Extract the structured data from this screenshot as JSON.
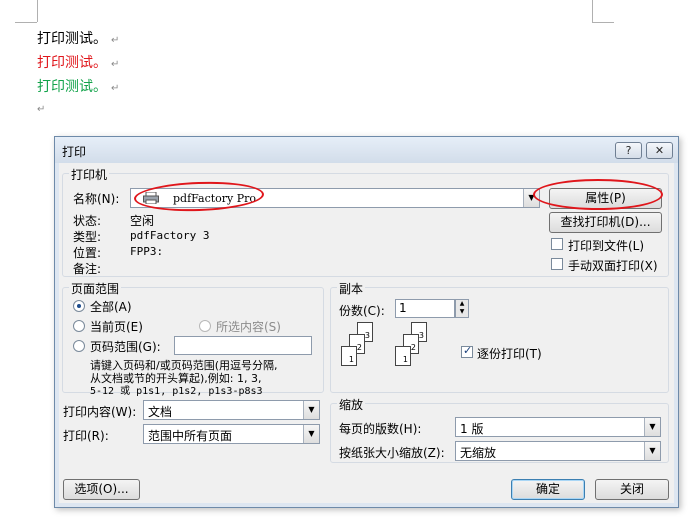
{
  "document": {
    "lines": [
      {
        "text": "打印测试。",
        "color": "#000000"
      },
      {
        "text": "打印测试。",
        "color": "#e0161b"
      },
      {
        "text": "打印测试。",
        "color": "#12a34a"
      }
    ],
    "paragraph_mark": "↵"
  },
  "dialog": {
    "title": "打印",
    "help_label": "?",
    "close_label": "✕",
    "printer": {
      "group_label": "打印机",
      "name_label": "名称(N):",
      "name_value": "pdfFactory Pro",
      "status_label": "状态:",
      "status_value": "空闲",
      "type_label": "类型:",
      "type_value": "pdfFactory 3",
      "location_label": "位置:",
      "location_value": "FPP3:",
      "comment_label": "备注:",
      "comment_value": "",
      "properties_button": "属性(P)",
      "find_printer_button": "查找打印机(D)...",
      "print_to_file_label": "打印到文件(L)",
      "print_to_file_checked": false,
      "duplex_label": "手动双面打印(X)",
      "duplex_checked": false
    },
    "page_range": {
      "group_label": "页面范围",
      "all_label": "全部(A)",
      "current_label": "当前页(E)",
      "selection_label": "所选内容(S)",
      "pages_label": "页码范围(G):",
      "pages_value": "",
      "selected": "all",
      "hint_line1": "请键入页码和/或页码范围(用逗号分隔,",
      "hint_line2": "从文档或节的开头算起),例如: 1, 3,",
      "hint_line3": "5-12 或 p1s1, p1s2, p1s3-p8s3"
    },
    "copies": {
      "group_label": "副本",
      "count_label": "份数(C):",
      "count_value": "1",
      "collate_label": "逐份打印(T)",
      "collate_checked": true,
      "collate_pages_a": [
        "1",
        "2",
        "3"
      ],
      "collate_pages_b": [
        "1",
        "2",
        "3"
      ]
    },
    "print_what_label": "打印内容(W):",
    "print_what_value": "文档",
    "print_label": "打印(R):",
    "print_value": "范围中所有页面",
    "zoom": {
      "group_label": "缩放",
      "pages_per_sheet_label": "每页的版数(H):",
      "pages_per_sheet_value": "1 版",
      "scale_label": "按纸张大小缩放(Z):",
      "scale_value": "无缩放"
    },
    "options_button": "选项(O)...",
    "ok_button": "确定",
    "close_button": "关闭"
  },
  "colors": {
    "annotation": "#e0161b",
    "dialog_frame": "#dde6f1",
    "dialog_body": "#f0f0f0"
  }
}
